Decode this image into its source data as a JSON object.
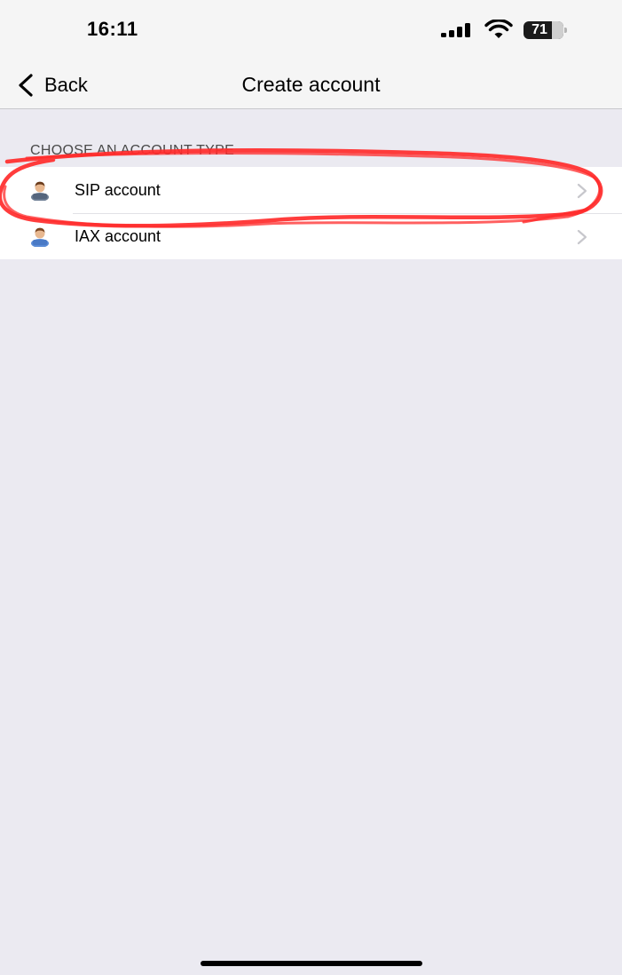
{
  "status_bar": {
    "time": "16:11",
    "battery_level": "71",
    "icons": [
      "signal-icon",
      "wifi-icon",
      "battery-icon"
    ]
  },
  "nav": {
    "back_label": "Back",
    "title": "Create account"
  },
  "section": {
    "header": "CHOOSE AN ACCOUNT TYPE",
    "items": [
      {
        "label": "SIP account",
        "icon": "user-icon"
      },
      {
        "label": "IAX account",
        "icon": "user-icon"
      }
    ]
  },
  "colors": {
    "background": "#ebeaf1",
    "annotation": "#ff2b2b"
  }
}
